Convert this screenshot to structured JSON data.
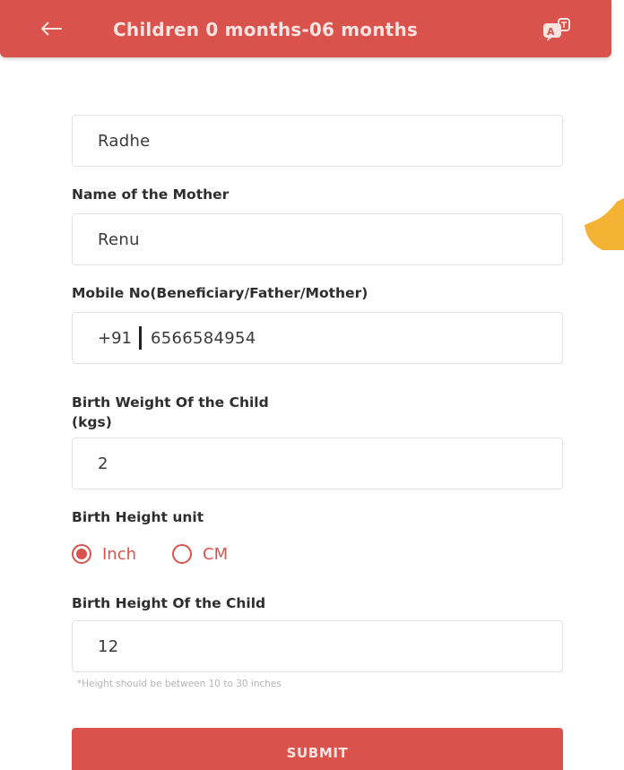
{
  "header": {
    "back_icon": "arrow-left-icon",
    "title": "Children 0 months-06 months",
    "translate_icon": "translate-icon",
    "color": "#d9534c"
  },
  "form": {
    "child_name": {
      "value": "Radhe"
    },
    "mother_name": {
      "label": "Name of the Mother",
      "value": "Renu"
    },
    "mobile": {
      "label": "Mobile No(Beneficiary/Father/Mother)",
      "prefix": "+91",
      "value": "6566584954"
    },
    "birth_weight": {
      "label_line1": "Birth Weight Of the Child",
      "label_line2": "(kgs)",
      "value": "2"
    },
    "height_unit": {
      "label": "Birth Height unit",
      "options": [
        {
          "label": "Inch",
          "selected": true
        },
        {
          "label": "CM",
          "selected": false
        }
      ]
    },
    "birth_height": {
      "label": "Birth Height Of the Child",
      "value": "12",
      "hint": "*Height should be between 10 to 30 inches"
    },
    "submit_label": "SUBMIT"
  },
  "colors": {
    "accent": "#d9534c",
    "decor_orange": "#f5b335"
  }
}
